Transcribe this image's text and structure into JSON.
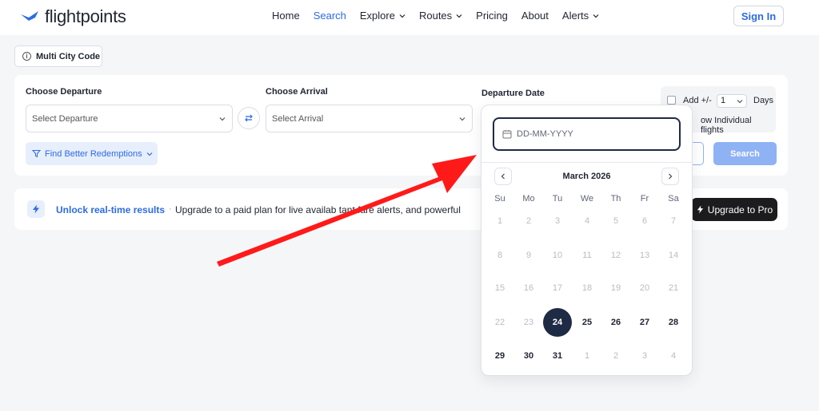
{
  "header": {
    "logo_text": "flightpoints",
    "nav": [
      {
        "label": "Home",
        "dropdown": false,
        "active": false
      },
      {
        "label": "Search",
        "dropdown": false,
        "active": true
      },
      {
        "label": "Explore",
        "dropdown": true,
        "active": false
      },
      {
        "label": "Routes",
        "dropdown": true,
        "active": false
      },
      {
        "label": "Pricing",
        "dropdown": false,
        "active": false
      },
      {
        "label": "About",
        "dropdown": false,
        "active": false
      },
      {
        "label": "Alerts",
        "dropdown": true,
        "active": false
      }
    ],
    "signin_label": "Sign In"
  },
  "multicity_label": "Multi City Code",
  "search": {
    "departure_label": "Choose Departure",
    "departure_placeholder": "Select Departure",
    "arrival_label": "Choose Arrival",
    "arrival_placeholder": "Select Arrival",
    "date_label": "Departure Date",
    "find_label": "Find Better Redemptions",
    "add_days_label": "Add +/-",
    "days_value": "1",
    "days_label": "Days",
    "show_individual_label": "ow Individual flights",
    "search_label": "Search"
  },
  "banner": {
    "title": "Unlock real-time results",
    "text": "Upgrade to a paid plan for live availab     tant fare alerts, and powerful",
    "upgrade_label": "Upgrade to Pro"
  },
  "datepicker": {
    "placeholder": "DD-MM-YYYY",
    "month": "March 2026",
    "weekdays": [
      "Su",
      "Mo",
      "Tu",
      "We",
      "Th",
      "Fr",
      "Sa"
    ],
    "weeks": [
      [
        {
          "d": "1",
          "s": "muted"
        },
        {
          "d": "2",
          "s": "muted"
        },
        {
          "d": "3",
          "s": "muted"
        },
        {
          "d": "4",
          "s": "muted"
        },
        {
          "d": "5",
          "s": "muted"
        },
        {
          "d": "6",
          "s": "muted"
        },
        {
          "d": "7",
          "s": "muted"
        }
      ],
      [
        {
          "d": "8",
          "s": "muted"
        },
        {
          "d": "9",
          "s": "muted"
        },
        {
          "d": "10",
          "s": "muted"
        },
        {
          "d": "11",
          "s": "muted"
        },
        {
          "d": "12",
          "s": "muted"
        },
        {
          "d": "13",
          "s": "muted"
        },
        {
          "d": "14",
          "s": "muted"
        }
      ],
      [
        {
          "d": "15",
          "s": "muted"
        },
        {
          "d": "16",
          "s": "muted"
        },
        {
          "d": "17",
          "s": "muted"
        },
        {
          "d": "18",
          "s": "muted"
        },
        {
          "d": "19",
          "s": "muted"
        },
        {
          "d": "20",
          "s": "muted"
        },
        {
          "d": "21",
          "s": "muted"
        }
      ],
      [
        {
          "d": "22",
          "s": "muted"
        },
        {
          "d": "23",
          "s": "muted"
        },
        {
          "d": "24",
          "s": "selected"
        },
        {
          "d": "25",
          "s": "active"
        },
        {
          "d": "26",
          "s": "active"
        },
        {
          "d": "27",
          "s": "active"
        },
        {
          "d": "28",
          "s": "active"
        }
      ],
      [
        {
          "d": "29",
          "s": "active"
        },
        {
          "d": "30",
          "s": "active"
        },
        {
          "d": "31",
          "s": "active"
        },
        {
          "d": "1",
          "s": "muted"
        },
        {
          "d": "2",
          "s": "muted"
        },
        {
          "d": "3",
          "s": "muted"
        },
        {
          "d": "4",
          "s": "muted"
        }
      ]
    ]
  },
  "colors": {
    "accent": "#2d6be4",
    "selected_day": "#1f2a44",
    "annotation_arrow": "#ff1a1a"
  }
}
